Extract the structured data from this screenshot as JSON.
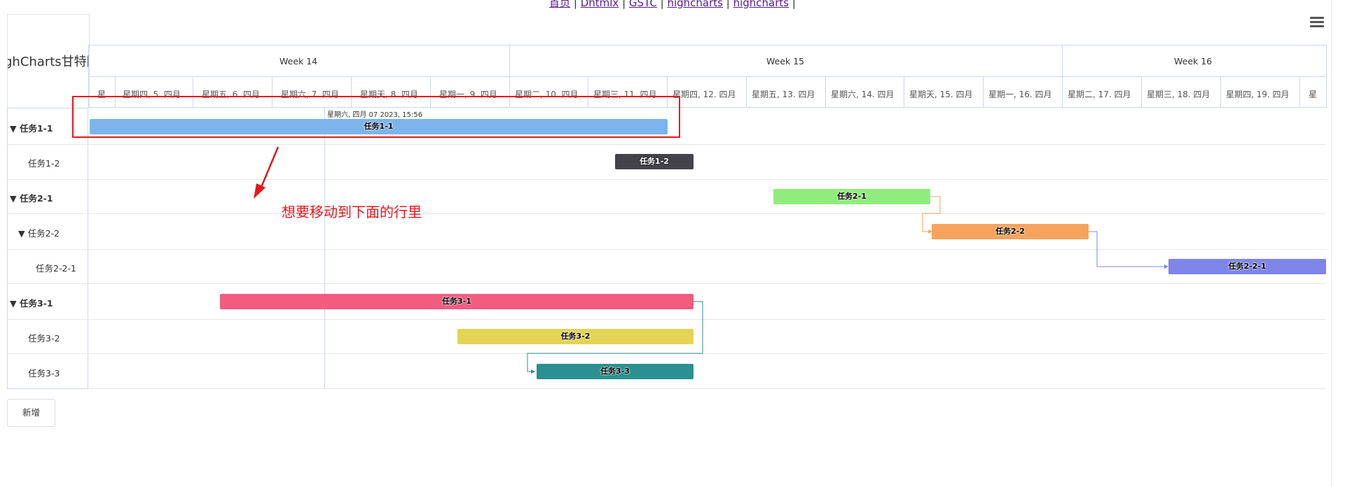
{
  "nav": {
    "links": [
      "首页",
      "Dhtmlx",
      "GSTC",
      "highcharts",
      "highcharts"
    ],
    "separator": "|"
  },
  "chart": {
    "title": "ighCharts甘特图",
    "weeks": [
      "Week 14",
      "Week 15",
      "Week 16"
    ],
    "days": [
      "星",
      "星期四, 5. 四月",
      "星期五, 6. 四月",
      "星期六, 7. 四月",
      "星期天, 8. 四月",
      "星期一, 9. 四月",
      "星期二, 10. 四月",
      "星期三, 11. 四月",
      "星期四, 12. 四月",
      "星期五, 13. 四月",
      "星期六, 14. 四月",
      "星期天, 15. 四月",
      "星期一, 16. 四月",
      "星期二, 17. 四月",
      "星期三, 18. 四月",
      "星期四, 19. 四月",
      "星"
    ],
    "today_label": "星期六, 四月 07 2023, 15:56",
    "rows": [
      {
        "label": "▼ 任务1-1",
        "bar_label": "任务1-1",
        "color": "#7cb5ec"
      },
      {
        "label": "任务1-2",
        "bar_label": "任务1-2",
        "color": "#434348"
      },
      {
        "label": "▼ 任务2-1",
        "bar_label": "任务2-1",
        "color": "#90ed7d"
      },
      {
        "label": "▼ 任务2-2",
        "bar_label": "任务2-2",
        "color": "#f7a35c"
      },
      {
        "label": "任务2-2-1",
        "bar_label": "任务2-2-1",
        "color": "#8085e9"
      },
      {
        "label": "▼ 任务3-1",
        "bar_label": "任务3-1",
        "color": "#f15c80"
      },
      {
        "label": "任务3-2",
        "bar_label": "任务3-2",
        "color": "#e4d354"
      },
      {
        "label": "任务3-3",
        "bar_label": "任务3-3",
        "color": "#2b908f"
      }
    ]
  },
  "annotation": {
    "text": "想要移动到下面的行里",
    "color": "#e8161b"
  },
  "buttons": {
    "add_label": "新增"
  },
  "icons": {
    "menu": "hamburger-menu-icon",
    "arrow": "red-arrow-icon"
  }
}
